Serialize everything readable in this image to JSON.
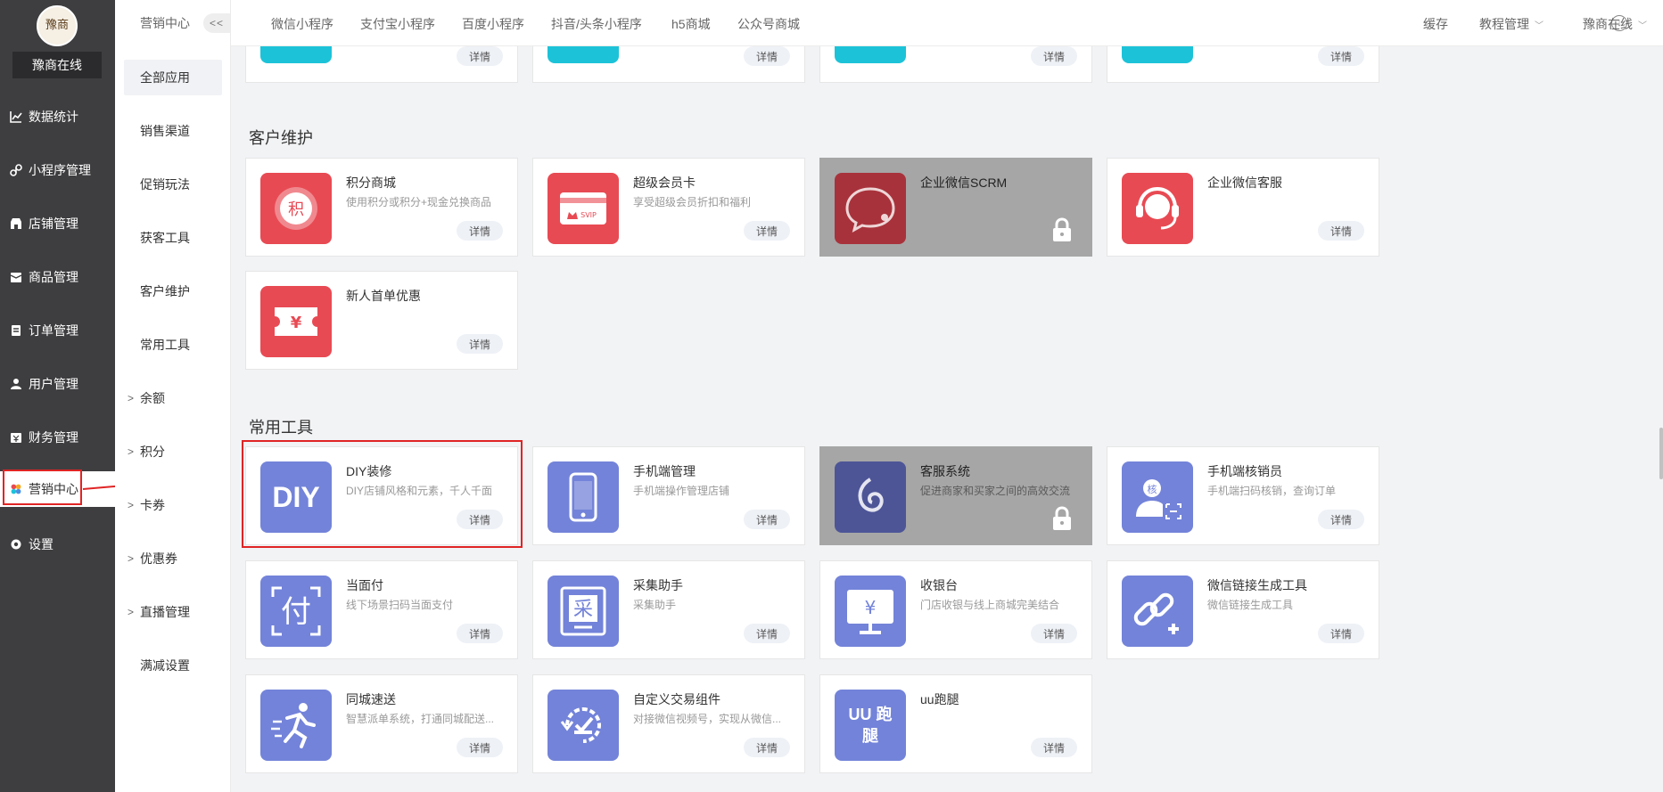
{
  "sidebar": {
    "logo_text": "豫商",
    "brand": "豫商在线",
    "items": [
      {
        "label": "数据统计",
        "icon": "chart-line-icon"
      },
      {
        "label": "小程序管理",
        "icon": "miniprogram-icon"
      },
      {
        "label": "店铺管理",
        "icon": "store-icon"
      },
      {
        "label": "商品管理",
        "icon": "box-icon"
      },
      {
        "label": "订单管理",
        "icon": "order-icon"
      },
      {
        "label": "用户管理",
        "icon": "user-icon"
      },
      {
        "label": "财务管理",
        "icon": "finance-icon"
      },
      {
        "label": "营销中心",
        "icon": "marketing-icon"
      },
      {
        "label": "设置",
        "icon": "gear-icon"
      }
    ]
  },
  "submenu": {
    "title": "营销中心",
    "collapse": "<<",
    "items": [
      {
        "label": "全部应用"
      },
      {
        "label": "销售渠道"
      },
      {
        "label": "促销玩法"
      },
      {
        "label": "获客工具"
      },
      {
        "label": "客户维护"
      },
      {
        "label": "常用工具"
      },
      {
        "label": "余额",
        "arrow": ">"
      },
      {
        "label": "积分",
        "arrow": ">"
      },
      {
        "label": "卡券",
        "arrow": ">"
      },
      {
        "label": "优惠券",
        "arrow": ">"
      },
      {
        "label": "直播管理",
        "arrow": ">"
      },
      {
        "label": "满减设置"
      }
    ]
  },
  "topbar": {
    "tabs": [
      "微信小程序",
      "支付宝小程序",
      "百度小程序",
      "抖音/头条小程序",
      "h5商城",
      "公众号商城"
    ],
    "cache": "缓存",
    "tutorial": "教程管理",
    "account": "豫商在线"
  },
  "detail_label": "详情",
  "sections": {
    "customer": "客户维护",
    "tools": "常用工具"
  },
  "cards": {
    "points_mall": {
      "name": "积分商城",
      "desc": "使用积分或积分+现金兑换商品",
      "icon_text": "积"
    },
    "super_vip": {
      "name": "超级会员卡",
      "desc": "享受超级会员折扣和福利",
      "icon_text": "SVIP"
    },
    "wework_scrm": {
      "name": "企业微信SCRM",
      "desc": ""
    },
    "wework_service": {
      "name": "企业微信客服",
      "desc": ""
    },
    "new_user": {
      "name": "新人首单优惠",
      "desc": "",
      "icon_text": "¥"
    },
    "diy": {
      "name": "DIY装修",
      "desc": "DIY店铺风格和元素，千人千面",
      "icon_text": "DIY"
    },
    "mobile_admin": {
      "name": "手机端管理",
      "desc": "手机端操作管理店铺"
    },
    "service_sys": {
      "name": "客服系统",
      "desc": "促进商家和买家之间的高效交流"
    },
    "mobile_verify": {
      "name": "手机端核销员",
      "desc": "手机端扫码核销，查询订单",
      "icon_text": "核"
    },
    "face_pay": {
      "name": "当面付",
      "desc": "线下场景扫码当面支付",
      "icon_text": "付"
    },
    "collect": {
      "name": "采集助手",
      "desc": "采集助手",
      "icon_text": "采"
    },
    "cashier": {
      "name": "收银台",
      "desc": "门店收银与线上商城完美结合",
      "icon_text": "¥"
    },
    "wx_link": {
      "name": "微信链接生成工具",
      "desc": "微信链接生成工具"
    },
    "city_delivery": {
      "name": "同城速送",
      "desc": "智慧派单系统，打通同城配送..."
    },
    "custom_trade": {
      "name": "自定义交易组件",
      "desc": "对接微信视频号，实现从微信..."
    },
    "uu_run": {
      "name": "uu跑腿",
      "desc": "",
      "icon_text": "UU 跑腿"
    }
  },
  "colors": {
    "sidebar_bg": "#3e3e40",
    "red_icon": "#e84a53",
    "blue_icon": "#7383d9",
    "cyan_icon": "#1cc3d8",
    "highlight": "#e02424",
    "locked_bg": "#a6a6a6"
  }
}
